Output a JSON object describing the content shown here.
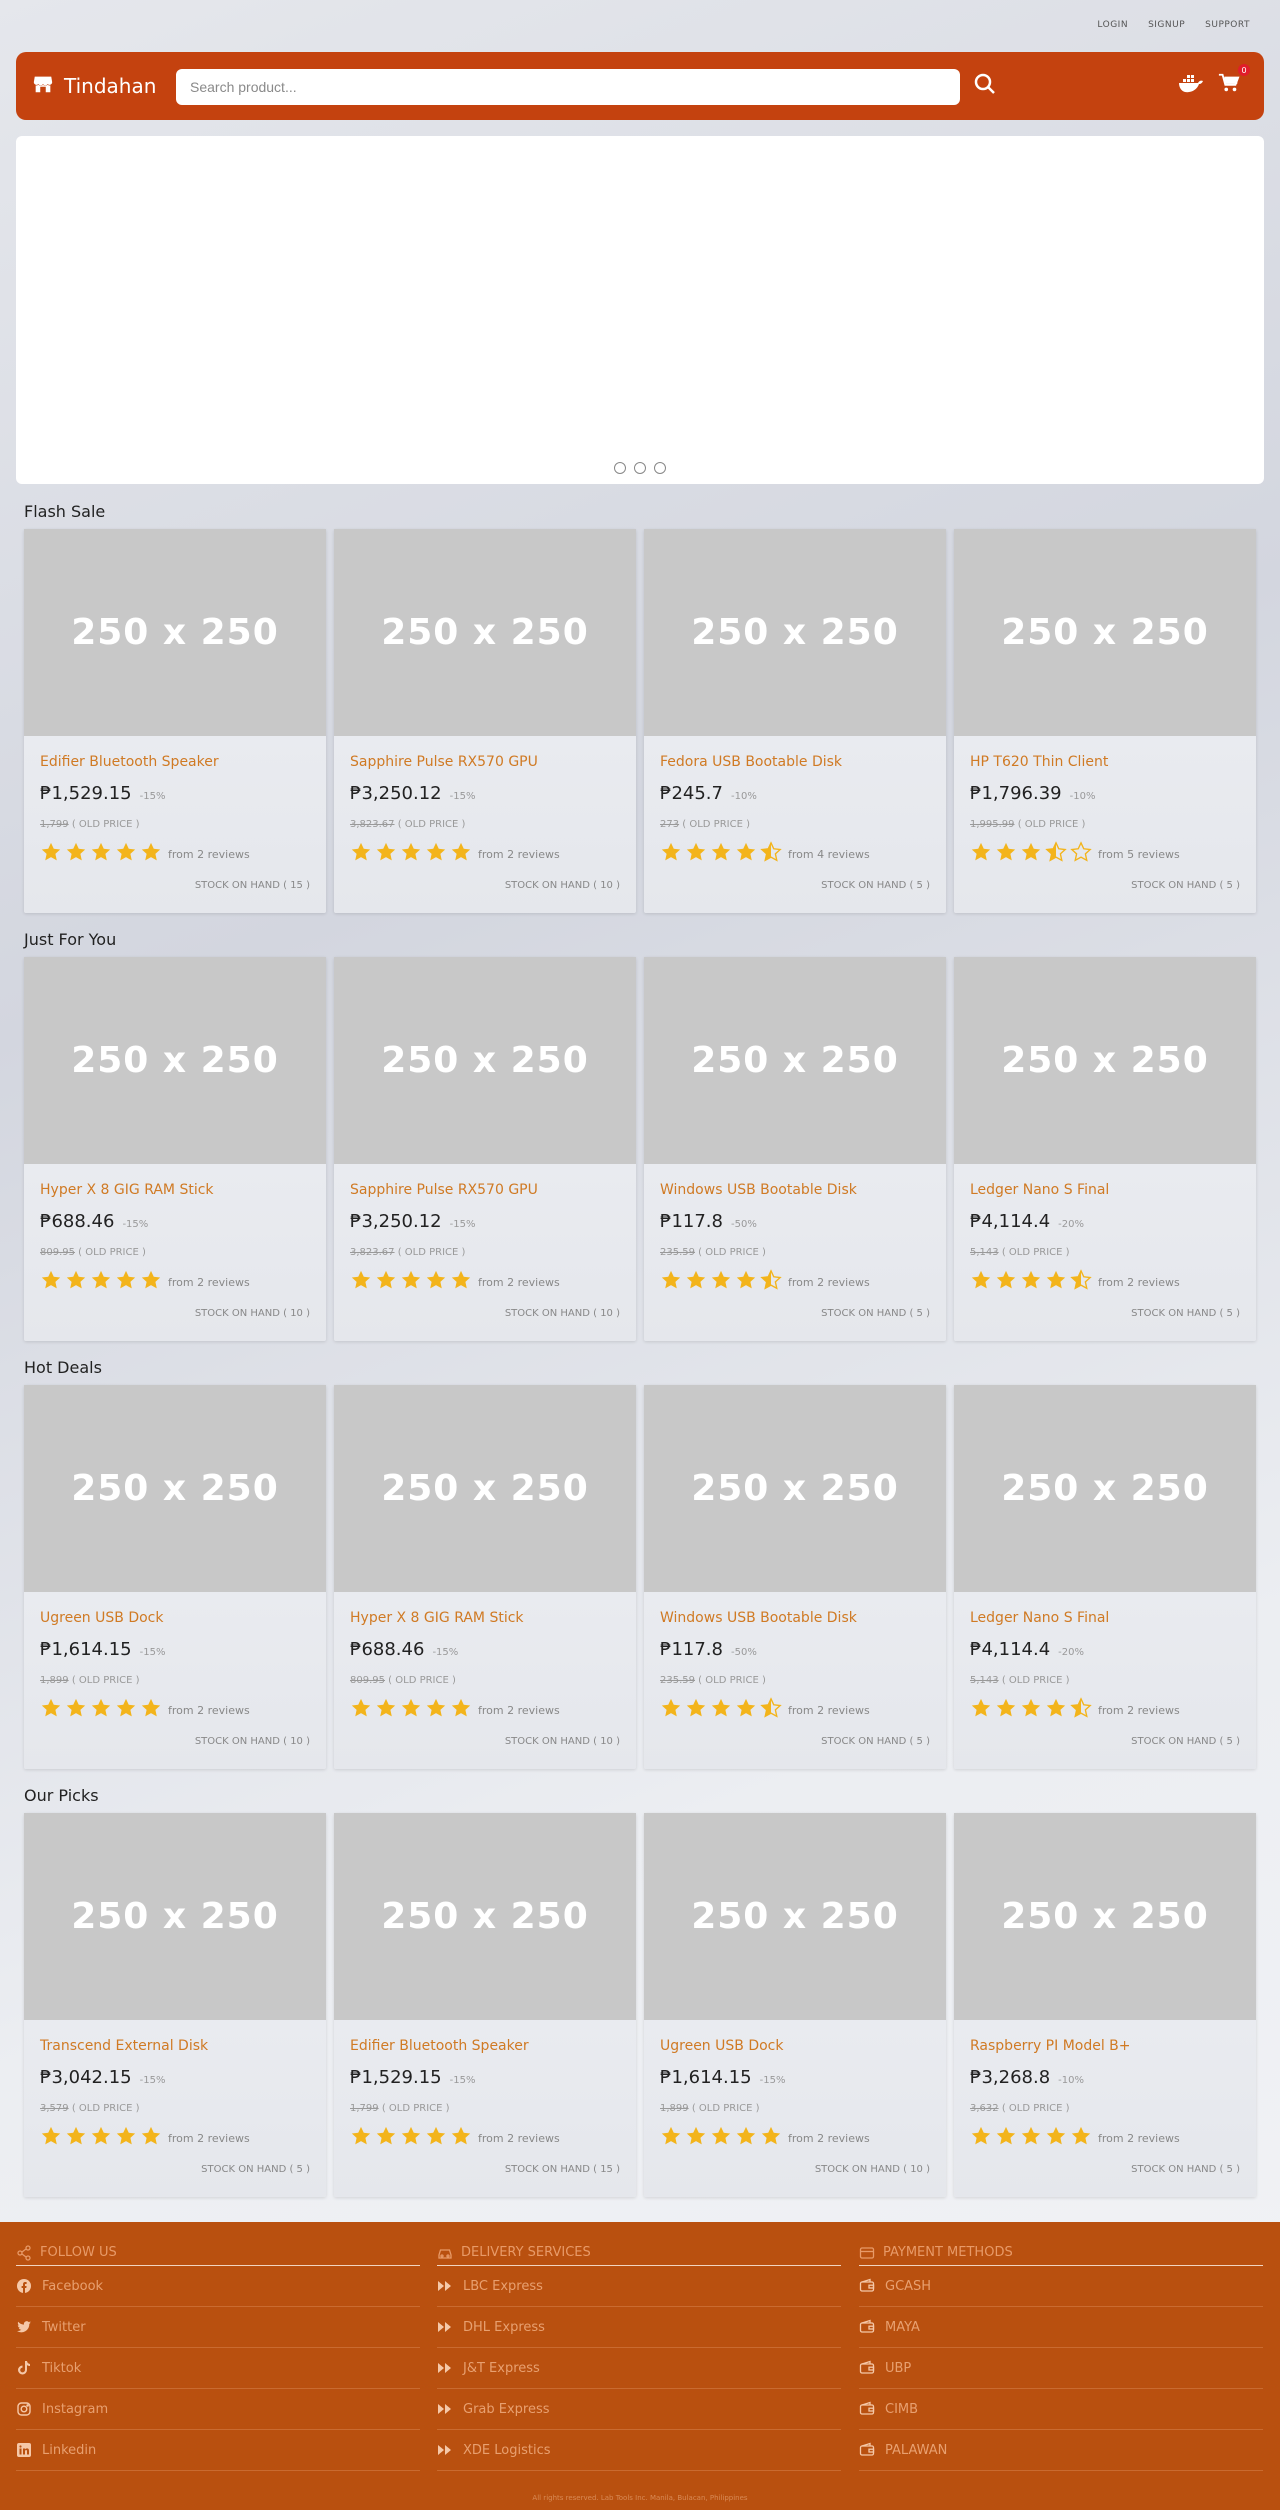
{
  "top_links": {
    "login": "LOGIN",
    "signup": "SIGNUP",
    "support": "SUPPORT"
  },
  "navbar": {
    "brand": "Tindahan",
    "search_placeholder": "Search product...",
    "cart_count": "0"
  },
  "thumb_label": "250 x 250",
  "sections": [
    {
      "title": "Flash Sale",
      "products": [
        {
          "name": "Edifier Bluetooth Speaker",
          "price": "₱1,529.15",
          "discount": "-15%",
          "old_price": "1,799",
          "old_suffix": " ( OLD PRICE )",
          "stars": 5,
          "reviews": "from 2 reviews",
          "stock": "STOCK ON HAND ( 15 )"
        },
        {
          "name": "Sapphire Pulse RX570 GPU",
          "price": "₱3,250.12",
          "discount": "-15%",
          "old_price": "3,823.67",
          "old_suffix": " ( OLD PRICE )",
          "stars": 5,
          "reviews": "from 2 reviews",
          "stock": "STOCK ON HAND ( 10 )"
        },
        {
          "name": "Fedora USB Bootable Disk",
          "price": "₱245.7",
          "discount": "-10%",
          "old_price": "273",
          "old_suffix": " ( OLD PRICE )",
          "stars": 4.5,
          "reviews": "from 4 reviews",
          "stock": "STOCK ON HAND ( 5 )"
        },
        {
          "name": "HP T620 Thin Client",
          "price": "₱1,796.39",
          "discount": "-10%",
          "old_price": "1,995.99",
          "old_suffix": " ( OLD PRICE )",
          "stars": 3.5,
          "reviews": "from 5 reviews",
          "stock": "STOCK ON HAND ( 5 )"
        }
      ]
    },
    {
      "title": "Just For You",
      "products": [
        {
          "name": "Hyper X 8 GIG RAM Stick",
          "price": "₱688.46",
          "discount": "-15%",
          "old_price": "809.95",
          "old_suffix": " ( OLD PRICE )",
          "stars": 5,
          "reviews": "from 2 reviews",
          "stock": "STOCK ON HAND ( 10 )"
        },
        {
          "name": "Sapphire Pulse RX570 GPU",
          "price": "₱3,250.12",
          "discount": "-15%",
          "old_price": "3,823.67",
          "old_suffix": " ( OLD PRICE )",
          "stars": 5,
          "reviews": "from 2 reviews",
          "stock": "STOCK ON HAND ( 10 )"
        },
        {
          "name": "Windows USB Bootable Disk",
          "price": "₱117.8",
          "discount": "-50%",
          "old_price": "235.59",
          "old_suffix": " ( OLD PRICE )",
          "stars": 4.5,
          "reviews": "from 2 reviews",
          "stock": "STOCK ON HAND ( 5 )"
        },
        {
          "name": "Ledger Nano S Final",
          "price": "₱4,114.4",
          "discount": "-20%",
          "old_price": "5,143",
          "old_suffix": " ( OLD PRICE )",
          "stars": 4.5,
          "reviews": "from 2 reviews",
          "stock": "STOCK ON HAND ( 5 )"
        }
      ]
    },
    {
      "title": "Hot Deals",
      "products": [
        {
          "name": "Ugreen USB Dock",
          "price": "₱1,614.15",
          "discount": "-15%",
          "old_price": "1,899",
          "old_suffix": " ( OLD PRICE )",
          "stars": 5,
          "reviews": "from 2 reviews",
          "stock": "STOCK ON HAND ( 10 )"
        },
        {
          "name": "Hyper X 8 GIG RAM Stick",
          "price": "₱688.46",
          "discount": "-15%",
          "old_price": "809.95",
          "old_suffix": " ( OLD PRICE )",
          "stars": 5,
          "reviews": "from 2 reviews",
          "stock": "STOCK ON HAND ( 10 )"
        },
        {
          "name": "Windows USB Bootable Disk",
          "price": "₱117.8",
          "discount": "-50%",
          "old_price": "235.59",
          "old_suffix": " ( OLD PRICE )",
          "stars": 4.5,
          "reviews": "from 2 reviews",
          "stock": "STOCK ON HAND ( 5 )"
        },
        {
          "name": "Ledger Nano S Final",
          "price": "₱4,114.4",
          "discount": "-20%",
          "old_price": "5,143",
          "old_suffix": " ( OLD PRICE )",
          "stars": 4.5,
          "reviews": "from 2 reviews",
          "stock": "STOCK ON HAND ( 5 )"
        }
      ]
    },
    {
      "title": "Our Picks",
      "products": [
        {
          "name": "Transcend External Disk",
          "price": "₱3,042.15",
          "discount": "-15%",
          "old_price": "3,579",
          "old_suffix": " ( OLD PRICE )",
          "stars": 5,
          "reviews": "from 2 reviews",
          "stock": "STOCK ON HAND ( 5 )"
        },
        {
          "name": "Edifier Bluetooth Speaker",
          "price": "₱1,529.15",
          "discount": "-15%",
          "old_price": "1,799",
          "old_suffix": " ( OLD PRICE )",
          "stars": 5,
          "reviews": "from 2 reviews",
          "stock": "STOCK ON HAND ( 15 )"
        },
        {
          "name": "Ugreen USB Dock",
          "price": "₱1,614.15",
          "discount": "-15%",
          "old_price": "1,899",
          "old_suffix": " ( OLD PRICE )",
          "stars": 5,
          "reviews": "from 2 reviews",
          "stock": "STOCK ON HAND ( 10 )"
        },
        {
          "name": "Raspberry PI Model B+",
          "price": "₱3,268.8",
          "discount": "-10%",
          "old_price": "3,632",
          "old_suffix": " ( OLD PRICE )",
          "stars": 5,
          "reviews": "from 2 reviews",
          "stock": "STOCK ON HAND ( 5 )"
        }
      ]
    }
  ],
  "footer": {
    "columns": [
      {
        "heading": "FOLLOW US",
        "heading_icon": "share-icon",
        "items": [
          {
            "label": "Facebook",
            "icon": "facebook-icon"
          },
          {
            "label": "Twitter",
            "icon": "twitter-icon"
          },
          {
            "label": "Tiktok",
            "icon": "tiktok-icon"
          },
          {
            "label": "Instagram",
            "icon": "instagram-icon"
          },
          {
            "label": "Linkedin",
            "icon": "linkedin-icon"
          }
        ]
      },
      {
        "heading": "DELIVERY SERVICES",
        "heading_icon": "car-icon",
        "items": [
          {
            "label": "LBC Express",
            "icon": "fast-forward-icon"
          },
          {
            "label": "DHL Express",
            "icon": "fast-forward-icon"
          },
          {
            "label": "J&T Express",
            "icon": "fast-forward-icon"
          },
          {
            "label": "Grab Express",
            "icon": "fast-forward-icon"
          },
          {
            "label": "XDE Logistics",
            "icon": "fast-forward-icon"
          }
        ]
      },
      {
        "heading": "PAYMENT METHODS",
        "heading_icon": "credit-card-icon",
        "items": [
          {
            "label": "GCASH",
            "icon": "wallet-icon"
          },
          {
            "label": "MAYA",
            "icon": "wallet-icon"
          },
          {
            "label": "UBP",
            "icon": "wallet-icon"
          },
          {
            "label": "CIMB",
            "icon": "wallet-icon"
          },
          {
            "label": "PALAWAN",
            "icon": "wallet-icon"
          }
        ]
      }
    ],
    "copyright": "All rights reserved. Lab Tools Inc. Manila, Bulacan, Philippines"
  },
  "colors": {
    "brand": "#c4420f",
    "footer": "#b9500f",
    "accent_text": "#d07a24",
    "star": "#f3b41b"
  }
}
